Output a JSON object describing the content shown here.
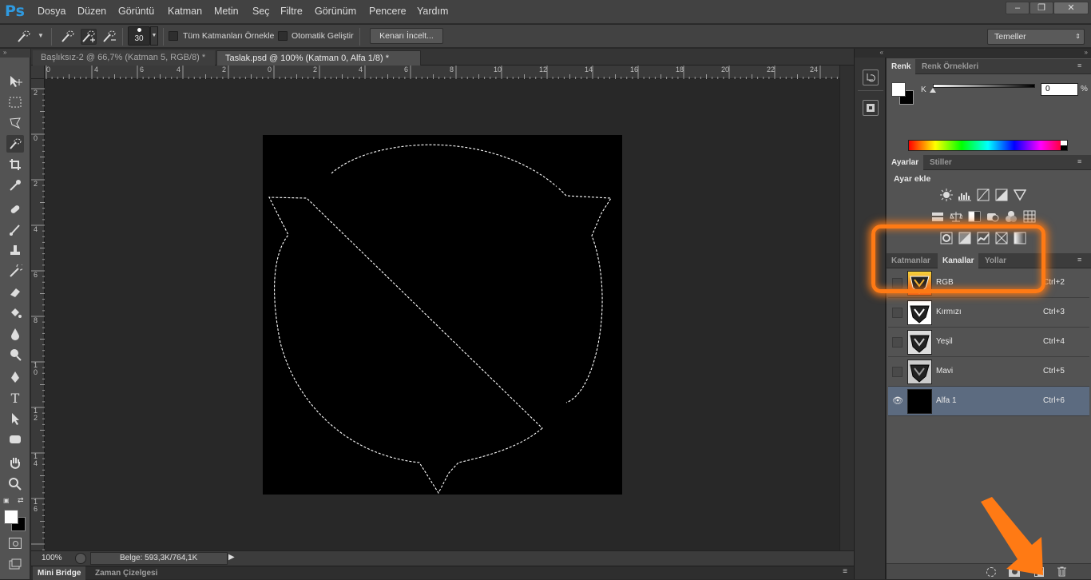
{
  "app": {
    "logo": "Ps"
  },
  "menu": [
    "Dosya",
    "Düzen",
    "Görüntü",
    "Katman",
    "Metin",
    "Seç",
    "Filtre",
    "Görünüm",
    "Pencere",
    "Yardım"
  ],
  "window_controls": {
    "minimize": "–",
    "restore": "❐",
    "close": "✕"
  },
  "options": {
    "brush_size": "30",
    "sample_all_layers": "Tüm Katmanları Örnekle",
    "auto_enhance": "Otomatik Geliştir",
    "refine_edge": "Kenarı İncelt...",
    "workspace": "Temeller"
  },
  "doc_tabs": [
    {
      "label": "Başlıksız-2 @ 66,7% (Katman 5, RGB/8) *",
      "active": false
    },
    {
      "label": "Taslak.psd @ 100% (Katman 0, Alfa 1/8) *",
      "active": true
    }
  ],
  "ruler": {
    "horizontal": [
      "0",
      "2",
      "4",
      "6",
      "8",
      "10",
      "12",
      "14",
      "16",
      "18",
      "20",
      "22",
      "24"
    ],
    "horizontal_neg": [
      "0"
    ],
    "vertical": [
      "2",
      "0",
      "2",
      "4",
      "6",
      "8",
      "1 0",
      "1 2",
      "1 4",
      "1 6"
    ]
  },
  "status": {
    "zoom": "100%",
    "doc_info": "Belge: 593,3K/764,1K"
  },
  "bottom_tabs": [
    "Mini Bridge",
    "Zaman Çizelgesi"
  ],
  "color_panel": {
    "tabs": [
      "Renk",
      "Renk Örnekleri"
    ],
    "channel_label": "K",
    "value": "0",
    "unit": "%"
  },
  "adjustments_panel": {
    "tabs": [
      "Ayarlar",
      "Stiller"
    ],
    "heading": "Ayar ekle"
  },
  "channels_panel": {
    "tabs": [
      "Katmanlar",
      "Kanallar",
      "Yollar"
    ],
    "active_tab": "Kanallar",
    "channels": [
      {
        "name": "RGB",
        "shortcut": "Ctrl+2",
        "visible": false,
        "selected": false
      },
      {
        "name": "Kırmızı",
        "shortcut": "Ctrl+3",
        "visible": false,
        "selected": false
      },
      {
        "name": "Yeşil",
        "shortcut": "Ctrl+4",
        "visible": false,
        "selected": false
      },
      {
        "name": "Mavi",
        "shortcut": "Ctrl+5",
        "visible": false,
        "selected": false
      },
      {
        "name": "Alfa 1",
        "shortcut": "Ctrl+6",
        "visible": true,
        "selected": true
      }
    ]
  },
  "colors": {
    "highlight": "#ff7a14",
    "selected_row": "#5c6b80",
    "ps_blue": "#2f9ae0"
  }
}
